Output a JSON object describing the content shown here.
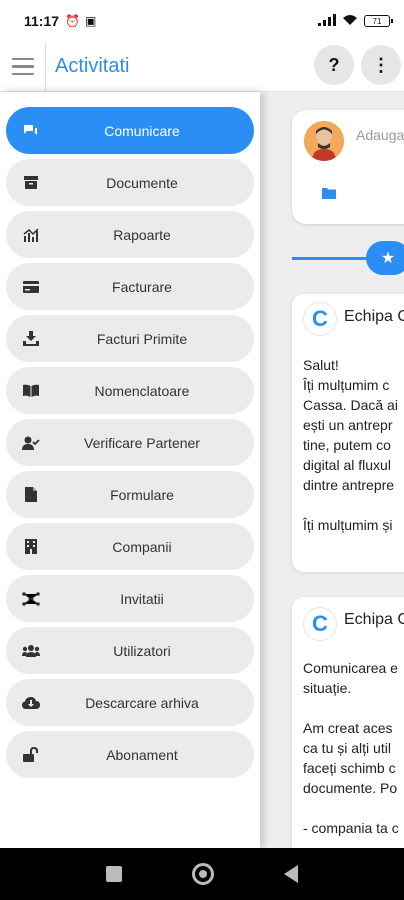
{
  "status_bar": {
    "time": "11:17",
    "battery": "71"
  },
  "app_bar": {
    "title": "Activitati",
    "help_label": "?",
    "more_label": "⋮"
  },
  "drawer": {
    "items": [
      {
        "label": "Comunicare",
        "icon": "chat-icon",
        "active": true
      },
      {
        "label": "Documente",
        "icon": "archive-box-icon"
      },
      {
        "label": "Rapoarte",
        "icon": "chart-icon"
      },
      {
        "label": "Facturare",
        "icon": "credit-card-icon"
      },
      {
        "label": "Facturi Primite",
        "icon": "download-tray-icon"
      },
      {
        "label": "Nomenclatoare",
        "icon": "book-icon"
      },
      {
        "label": "Verificare Partener",
        "icon": "user-check-icon"
      },
      {
        "label": "Formulare",
        "icon": "file-icon"
      },
      {
        "label": "Companii",
        "icon": "building-icon"
      },
      {
        "label": "Invitatii",
        "icon": "network-icon"
      },
      {
        "label": "Utilizatori",
        "icon": "users-icon"
      },
      {
        "label": "Descarcare arhiva",
        "icon": "cloud-download-icon"
      },
      {
        "label": "Abonament",
        "icon": "unlock-icon"
      }
    ]
  },
  "feed": {
    "compose_placeholder": "Adauga",
    "posts": [
      {
        "author": "Echipa C",
        "body": "Salut!\nÎți mulțumim c\nCassa. Dacă ai\nești un antrepr\ntine, putem co\ndigital al fluxul\ndintre antrepre\n\nÎți mulțumim și"
      },
      {
        "author": "Echipa C",
        "body": "Comunicarea e\nsituație.\n\nAm creat aces\nca tu și alți util\nfaceți schimb c\ndocumente. Po\n\n- compania ta c"
      }
    ]
  },
  "colors": {
    "accent": "#2a8ef5"
  }
}
